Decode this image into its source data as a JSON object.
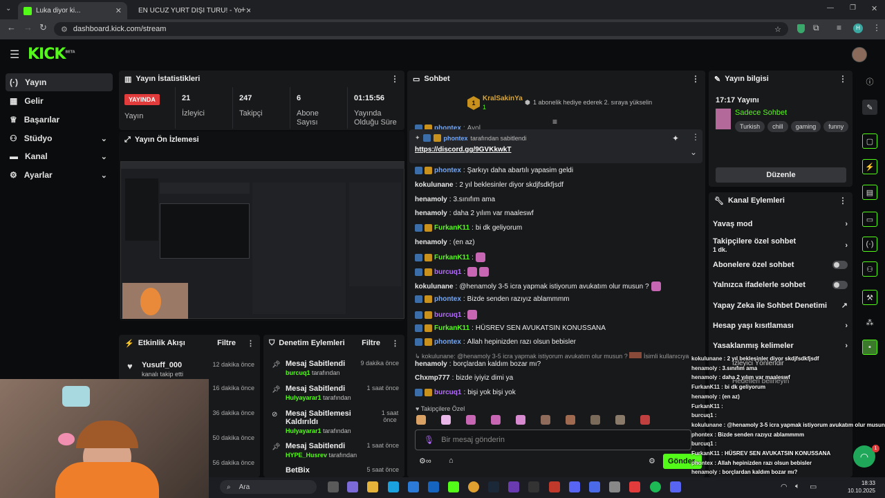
{
  "browser": {
    "tabs": [
      {
        "title": "Luka diyor ki...",
        "active": true
      },
      {
        "title": "EN UCUZ YURT DIŞI TURU! - Yo",
        "active": false
      }
    ],
    "url": "dashboard.kick.com/stream"
  },
  "brand": {
    "logo": "KICK",
    "beta": "BETA",
    "accent": "#53fc18"
  },
  "sidebar": {
    "items": [
      {
        "label": "Yayın",
        "icon": "broadcast-icon",
        "active": true
      },
      {
        "label": "Gelir",
        "icon": "revenue-icon"
      },
      {
        "label": "Başarılar",
        "icon": "trophy-icon"
      },
      {
        "label": "Stüdyo",
        "icon": "studio-icon",
        "expandable": true
      },
      {
        "label": "Kanal",
        "icon": "channel-icon",
        "expandable": true
      },
      {
        "label": "Ayarlar",
        "icon": "gear-icon",
        "expandable": true
      }
    ]
  },
  "stats": {
    "title": "Yayın İstatistikleri",
    "cells": [
      {
        "value": "YAYINDA",
        "label": "Yayın"
      },
      {
        "value": "21",
        "label": "İzleyici"
      },
      {
        "value": "247",
        "label": "Takipçi"
      },
      {
        "value": "6",
        "label": "Abone Sayısı"
      },
      {
        "value": "01:15:56",
        "label": "Yayında Olduğu Süre"
      }
    ]
  },
  "preview": {
    "title": "Yayın Ön İzlemesi"
  },
  "activity": {
    "title": "Etkinlik Akışı",
    "filter": "Filtre",
    "items": [
      {
        "user": "Yusuff_000",
        "desc": "kanalı takip etti",
        "time": "12 dakika önce"
      },
      {
        "time": "16 dakika önce"
      },
      {
        "time": "36 dakika önce"
      },
      {
        "time": "50 dakika önce"
      },
      {
        "time": "56 dakika önce"
      }
    ]
  },
  "moderation": {
    "title": "Denetim Eylemleri",
    "filter": "Filtre",
    "items": [
      {
        "action": "Mesaj Sabitlendi",
        "user": "burcuq1",
        "suffix": "tarafından",
        "time": "9 dakika önce"
      },
      {
        "action": "Mesaj Sabitlendi",
        "user": "Hulyayarar1",
        "suffix": "tarafından",
        "time": "1 saat önce"
      },
      {
        "action": "Mesaj Sabitlemesi Kaldırıldı",
        "user": "Hulyayarar1",
        "suffix": "tarafından",
        "time": "1 saat önce"
      },
      {
        "action": "Mesaj Sabitlendi",
        "user": "HYPE_Husrev",
        "suffix": "tarafından",
        "time": "1 saat önce"
      },
      {
        "action": "BetBix",
        "time": "5 saat önce"
      }
    ]
  },
  "chat": {
    "title": "Sohbet",
    "top_gifter": {
      "name": "KralSakinYa",
      "count": "1",
      "text": "1 abonelik hediye ederek 2. sıraya yükselin"
    },
    "pinned": {
      "user": "phontex",
      "by": "tarafından sabitlendi",
      "link": "https://discord.gg/9GVKkwkT"
    },
    "partial_top": {
      "user": "phontex",
      "text": "Ayol"
    },
    "messages": [
      {
        "user": "phontex",
        "text": "Şarkıyı daha abartılı yapasim geldi",
        "badges": true,
        "color": "#6fa8ff"
      },
      {
        "user": "kokulunane",
        "text": "2 yıl beklesinler diyor skdjfsdkfjsdf",
        "color": "#e8e8e8"
      },
      {
        "user": "henamoly",
        "text": "3.sınıfım ama",
        "color": "#e8e8e8"
      },
      {
        "user": "henamoly",
        "text": "daha 2 yılım var maaleswf",
        "color": "#e8e8e8"
      },
      {
        "user": "FurkanK11",
        "text": "bi dk geliyorum",
        "badges": true,
        "color": "#53fc18"
      },
      {
        "user": "henamoly",
        "text": "(en az)",
        "color": "#e8e8e8"
      },
      {
        "user": "FurkanK11",
        "text": "",
        "badges": true,
        "color": "#53fc18",
        "emotes": 1
      },
      {
        "user": "burcuq1",
        "text": "",
        "badges": true,
        "color": "#b46cff",
        "emotes": 2
      },
      {
        "user": "kokulunane",
        "text": "@henamoly 3-5 icra yapmak istiyorum avukatım olur musun ?",
        "color": "#e8e8e8",
        "emotes": 1
      },
      {
        "user": "phontex",
        "text": "Bizde senden razıyız ablammmm",
        "badges": true,
        "color": "#6fa8ff"
      },
      {
        "user": "burcuq1",
        "text": "",
        "badges": true,
        "color": "#b46cff",
        "emotes": 1
      },
      {
        "user": "FurkanK11",
        "text": "HÜSREV SEN AVUKATSIN KONUSSANA",
        "badges": true,
        "color": "#53fc18"
      },
      {
        "user": "phontex",
        "text": "Allah hepinizden razı olsun bebisler",
        "badges": true,
        "color": "#6fa8ff"
      }
    ],
    "reply_hint": "kokulunane: @henamoly 3-5 icra yapmak istiyorum avukatım olur musun ?",
    "reply_hint_tail": "İsimli kullanıcıya yan",
    "after_reply": [
      {
        "user": "henamoly",
        "text": "borçlardan kaldım bozar mı?",
        "color": "#e8e8e8"
      },
      {
        "user": "Chxmp777",
        "text": "bizde iyiyiz dimi ya",
        "color": "#e8e8e8"
      },
      {
        "user": "burcuq1",
        "text": "bişi yok bişi yok",
        "badges": true,
        "color": "#b46cff"
      }
    ],
    "followers_only": "Takipçilere Özel",
    "input_placeholder": "Bir mesaj gönderin",
    "send": "Gönder"
  },
  "stream_info": {
    "title": "Yayın bilgisi",
    "time_title": "17:17 Yayını",
    "category": "Sadece Sohbet",
    "tags": [
      "Turkish",
      "chill",
      "gaming",
      "funny"
    ],
    "edit": "Düzenle"
  },
  "channel_actions": {
    "title": "Kanal Eylemleri",
    "items": [
      {
        "label": "Yavaş mod",
        "type": "arrow"
      },
      {
        "label": "Takipçilere özel sohbet",
        "sub": "1 dk.",
        "type": "arrow"
      },
      {
        "label": "Abonelere özel sohbet",
        "type": "toggle"
      },
      {
        "label": "Yalnızca ifadelerle sohbet",
        "type": "toggle"
      },
      {
        "label": "Yapay Zeka ile Sohbet Denetimi",
        "type": "external"
      },
      {
        "label": "Hesap yaşı kısıtlaması",
        "type": "arrow"
      },
      {
        "label": "Yasaklanmış kelimeler",
        "type": "arrow"
      }
    ],
    "overlay_partial": [
      "İzleyici Yönlendir",
      "Hedefleri belirleyin"
    ]
  },
  "overlay_chat": [
    {
      "user": "kokulunane",
      "text": "2 yıl beklesinler diyor skdjfsdkfjsdf"
    },
    {
      "user": "henamoly",
      "text": "3.sınıfım ama"
    },
    {
      "user": "henamoly",
      "text": "daha 2 yılım var maaleswf"
    },
    {
      "user": "FurkanK11",
      "text": "bi dk geliyorum"
    },
    {
      "user": "henamoly",
      "text": "(en az)"
    },
    {
      "user": "FurkanK11",
      "text": ""
    },
    {
      "user": "burcuq1",
      "text": ""
    },
    {
      "user": "kokulunane",
      "text": "@henamoly 3-5 icra yapmak istiyorum avukatım olur musun ?"
    },
    {
      "user": "phontex",
      "text": "Bizde senden razıyız ablammmm"
    },
    {
      "user": "burcuq1",
      "text": ""
    },
    {
      "user": "FurkanK11",
      "text": "HÜSREV SEN AVUKATSIN KONUSSANA"
    },
    {
      "user": "phontex",
      "text": "Allah hepinizden razı olsun bebisler"
    },
    {
      "user": "henamoly",
      "text": "borçlardan kaldım bozar mı?"
    },
    {
      "user": "Chxmp777",
      "text": "bizde iyiyiz dimi ya"
    },
    {
      "user": "burcuq1",
      "text": "bişi yok bişi yok"
    }
  ],
  "taskbar": {
    "search": "Ara",
    "time": "18:33",
    "date": "10.10.2025"
  },
  "support_badge": "1"
}
